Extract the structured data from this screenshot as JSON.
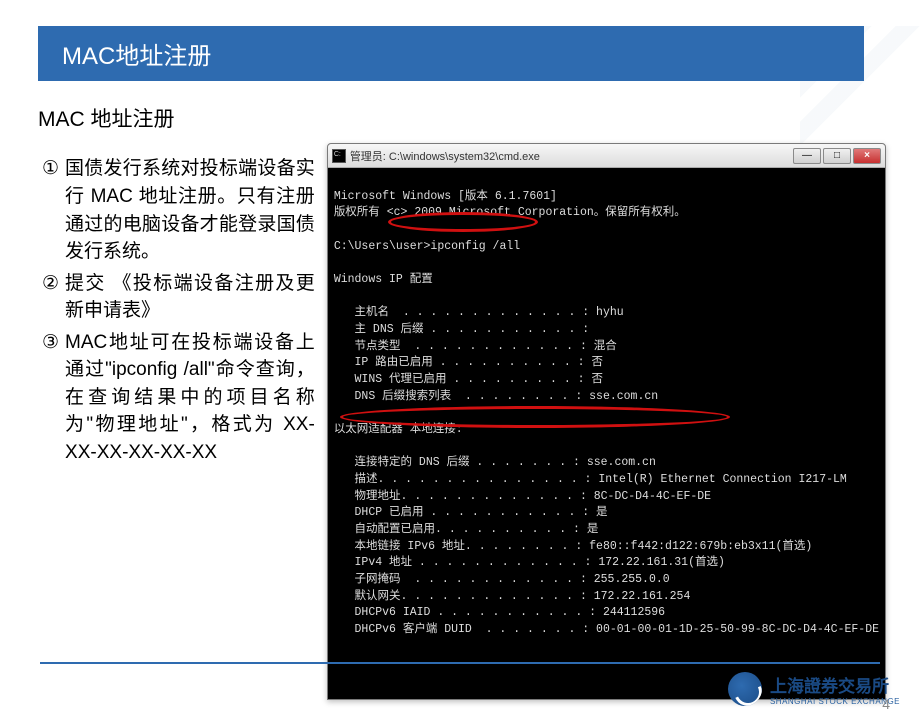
{
  "slide": {
    "title_bar": "MAC地址注册",
    "heading": "MAC 地址注册",
    "bullets": [
      {
        "num": "①",
        "text": "国债发行系统对投标端设备实行 MAC 地址注册。只有注册通过的电脑设备才能登录国债发行系统。"
      },
      {
        "num": "②",
        "text": "提交 《投标端设备注册及更新申请表》"
      },
      {
        "num": "③",
        "text": "MAC地址可在投标端设备上通过\"ipconfig /all\"命令查询，在查询结果中的项目名称为\"物理地址\"，格式为 XX-XX-XX-XX-XX-XX"
      }
    ]
  },
  "cmd": {
    "title": "管理员: C:\\windows\\system32\\cmd.exe",
    "btn_min": "—",
    "btn_max": "□",
    "btn_close": "×",
    "lines": {
      "l1": "Microsoft Windows [版本 6.1.7601]",
      "l2": "版权所有 <c> 2009 Microsoft Corporation。保留所有权利。",
      "blank1": "",
      "l3": "C:\\Users\\user>ipconfig /all",
      "blank2": "",
      "l4": "Windows IP 配置",
      "blank3": "",
      "l5": "   主机名  . . . . . . . . . . . . . : hyhu",
      "l6": "   主 DNS 后缀 . . . . . . . . . . . :",
      "l7": "   节点类型  . . . . . . . . . . . . : 混合",
      "l8": "   IP 路由已启用 . . . . . . . . . . : 否",
      "l9": "   WINS 代理已启用 . . . . . . . . . : 否",
      "l10": "   DNS 后缀搜索列表  . . . . . . . . : sse.com.cn",
      "blank4": "",
      "l11": "以太网适配器 本地连接:",
      "blank5": "",
      "l12": "   连接特定的 DNS 后缀 . . . . . . . : sse.com.cn",
      "l13": "   描述. . . . . . . . . . . . . . . : Intel(R) Ethernet Connection I217-LM",
      "l14": "   物理地址. . . . . . . . . . . . . : 8C-DC-D4-4C-EF-DE",
      "l15": "   DHCP 已启用 . . . . . . . . . . . : 是",
      "l16": "   自动配置已启用. . . . . . . . . . : 是",
      "l17": "   本地链接 IPv6 地址. . . . . . . . : fe80::f442:d122:679b:eb3x11(首选)",
      "l18": "   IPv4 地址 . . . . . . . . . . . . : 172.22.161.31(首选)",
      "l19": "   子网掩码  . . . . . . . . . . . . : 255.255.0.0",
      "l20": "   默认网关. . . . . . . . . . . . . : 172.22.161.254",
      "l21": "   DHCPv6 IAID . . . . . . . . . . . : 244112596",
      "l22": "   DHCPv6 客户端 DUID  . . . . . . . : 00-01-00-01-1D-25-50-99-8C-DC-D4-4C-EF-DE"
    }
  },
  "footer": {
    "org_cn": "上海證券交易所",
    "org_en": "SHANGHAI STOCK EXCHANGE",
    "page": "4"
  }
}
